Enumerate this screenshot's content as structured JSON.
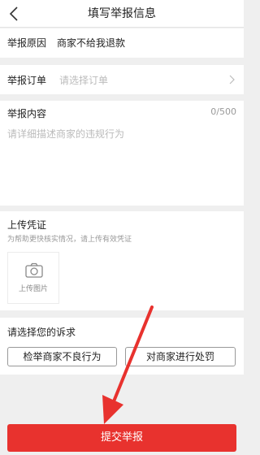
{
  "header": {
    "title": "填写举报信息"
  },
  "reason": {
    "label": "举报原因",
    "value": "商家不给我退款"
  },
  "order": {
    "label": "举报订单",
    "placeholder": "请选择订单"
  },
  "content": {
    "label": "举报内容",
    "counter": "0/500",
    "placeholder": "请详细描述商家的违规行为"
  },
  "evidence": {
    "label": "上传凭证",
    "hint": "为帮助更快核实情况，请上传有效凭证",
    "upload_label": "上传图片"
  },
  "claims": {
    "label": "请选择您的诉求",
    "options": [
      "检举商家不良行为",
      "对商家进行处罚"
    ]
  },
  "submit": {
    "label": "提交举报"
  },
  "colors": {
    "accent": "#e8322e",
    "annotation_arrow": "#e8322e"
  }
}
